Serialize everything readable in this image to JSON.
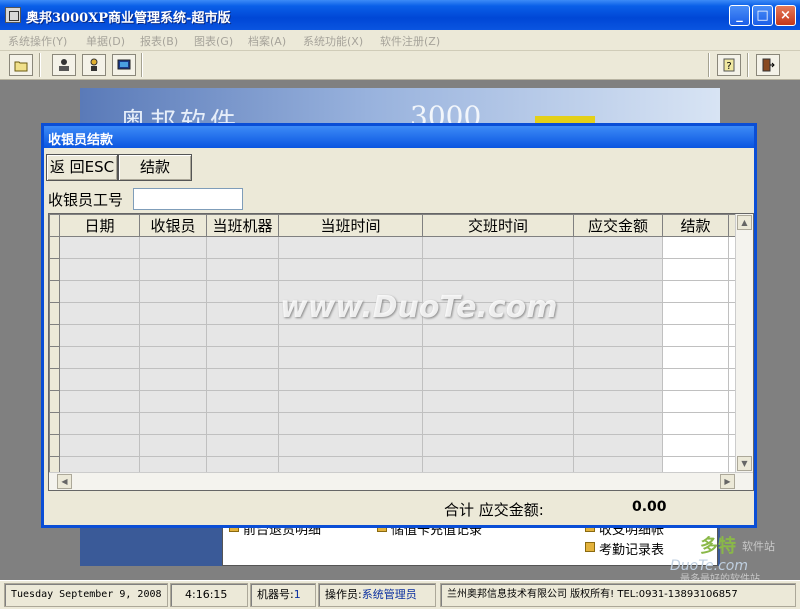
{
  "window": {
    "title": "奥邦3000XP商业管理系统-超市版"
  },
  "menu": [
    "系统操作(Y)",
    "单据(D)",
    "报表(B)",
    "图表(G)",
    "档案(A)",
    "系统功能(X)",
    "软件注册(Z)"
  ],
  "background": {
    "banner_text": "奥邦软件",
    "banner_number": "3000",
    "links": [
      "前台退货明细",
      "储值卡充值记录",
      "收支明细帐",
      "考勤记录表"
    ]
  },
  "dialog": {
    "title": "收银员结款",
    "back_button": "返 回ESC",
    "settle_button": "结款",
    "cashier_id_label": "收银员工号",
    "cashier_id_value": "",
    "columns": [
      "日期",
      "收银员",
      "当班机器",
      "当班时间",
      "交班时间",
      "应交金额",
      "结款"
    ],
    "total_label": "合计 应交金额:",
    "total_value": "0.00"
  },
  "watermark": "www.DuoTe.com",
  "logo_watermark": {
    "brand": "多特",
    "cn": "软件站",
    "url": "DuoTe.com",
    "tagline": "最多最好的软件站"
  },
  "status": {
    "date": "Tuesday September 9, 2008",
    "time": "4:16:15",
    "machine_label": "机器号:",
    "machine_value": "1",
    "operator_label": "操作员:",
    "operator_value": "系统管理员",
    "company": "兰州奥邦信息技术有限公司 版权所有! TEL:0931-13893106857"
  },
  "colors": {
    "titlebar": "#0a55e0",
    "workspace": "#808080",
    "status_value": "#0a2fa0"
  },
  "icons": [
    "folder-icon",
    "cashier-icon",
    "key-user-icon",
    "screen-icon",
    "help-icon",
    "exit-icon"
  ]
}
